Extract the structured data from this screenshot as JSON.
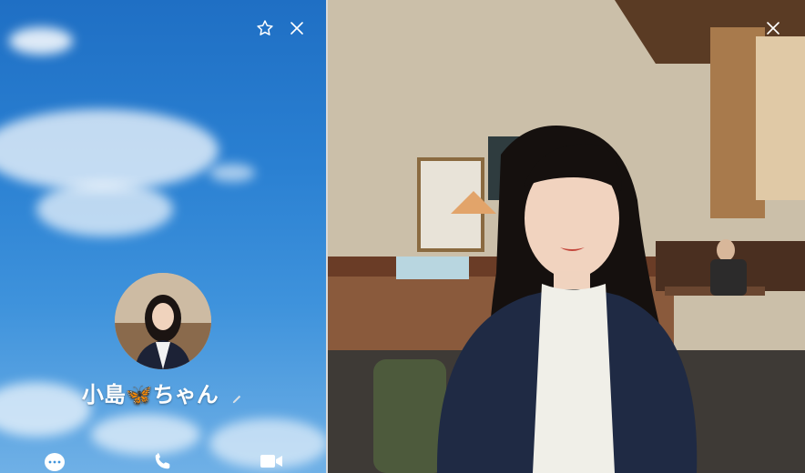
{
  "profile": {
    "display_name": "小島🦋ちゃん",
    "edit_icon": "pencil-icon",
    "favorite_icon": "star-icon",
    "close_icon": "close-icon"
  },
  "actions": [
    {
      "name": "chat",
      "icon": "chat-bubble-icon"
    },
    {
      "name": "call",
      "icon": "phone-icon"
    },
    {
      "name": "video",
      "icon": "video-camera-icon"
    }
  ],
  "photo_viewer": {
    "close_icon": "close-icon"
  },
  "colors": {
    "sky_top": "#1f6fc4",
    "sky_bottom": "#6fb0e6",
    "icon_white": "#ffffff"
  }
}
